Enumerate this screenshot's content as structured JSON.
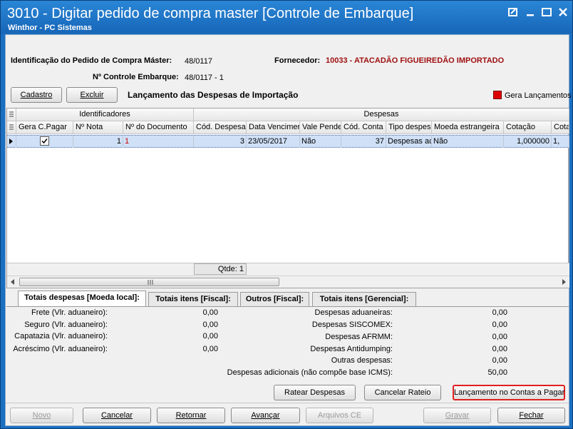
{
  "window": {
    "title": "3010 - Digitar pedido de compra master [Controle de Embarque]",
    "subtitle": "Winthor - PC Sistemas"
  },
  "header": {
    "pedido_label": "Identificação do Pedido de Compra Máster:",
    "pedido_value": "48/0117",
    "fornecedor_label": "Fornecedor:",
    "fornecedor_value": "10033 - ATACADÃO FIGUEIREDÃO IMPORTADO",
    "controle_label": "Nº Controle Embarque:",
    "controle_value": "48/0117 - 1"
  },
  "toolbar": {
    "cadastro": "Cadastro",
    "excluir": "Excluir",
    "section_title": "Lançamento das Despesas de Importação",
    "legend_label": "Gera Lançamentos"
  },
  "grid": {
    "group_headers": [
      "Identificadores",
      "Despesas"
    ],
    "columns": [
      "Gera C.Pagar",
      "Nº Nota",
      "Nº do Documento",
      "Cód. Despesa",
      "Data Vencimer",
      "Vale Pende",
      "Cód. Conta",
      "Tipo despesa",
      "Moeda estrangeira",
      "Cotação",
      "Cota"
    ],
    "rows": [
      [
        "",
        "1",
        "1",
        "3",
        "23/05/2017",
        "Não",
        "37",
        "Despesas ac",
        "Não",
        "1,000000",
        "1,"
      ]
    ],
    "qtde": "Qtde: 1"
  },
  "tabs": [
    "Totais despesas [Moeda local]:",
    "Totais itens [Fiscal]:",
    "Outros [Fiscal]:",
    "Totais itens [Gerencial]:"
  ],
  "totals_left": [
    {
      "label": "Frete (Vlr. aduaneiro):",
      "value": "0,00"
    },
    {
      "label": "Seguro (Vlr. aduaneiro):",
      "value": "0,00"
    },
    {
      "label": "Capatazia (Vlr. aduaneiro):",
      "value": "0,00"
    },
    {
      "label": "Acréscimo (Vlr. aduaneiro):",
      "value": "0,00"
    }
  ],
  "totals_right": [
    {
      "label": "Despesas aduaneiras:",
      "value": "0,00"
    },
    {
      "label": "Despesas SISCOMEX:",
      "value": "0,00"
    },
    {
      "label": "Despesas AFRMM:",
      "value": "0,00"
    },
    {
      "label": "Despesas Antidumping:",
      "value": "0,00"
    },
    {
      "label": "Outras despesas:",
      "value": "0,00"
    },
    {
      "label": "Despesas adicionais (não compõe base ICMS):",
      "value": "50,00"
    }
  ],
  "actions": {
    "ratear": "Ratear Despesas",
    "cancelar_rateio": "Cancelar Rateio",
    "lancamento": "Lançamento no Contas a Pagar"
  },
  "footer": {
    "novo": "Novo",
    "cancelar": "Cancelar",
    "retornar": "Retornar",
    "avancar": "Avançar",
    "arquivos": "Arquivos CE",
    "gravar": "Gravar",
    "fechar": "Fechar"
  },
  "colors": {
    "title_bar": "#1a6fc0",
    "accent_red": "#cc0000",
    "selected_row": "#cfe0f7",
    "highlight_border": "#e02020"
  }
}
